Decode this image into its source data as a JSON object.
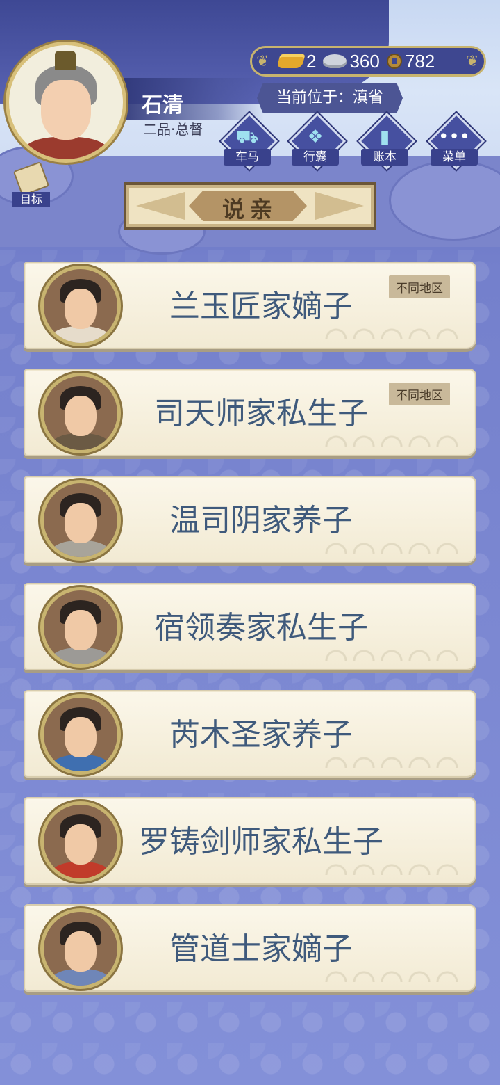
{
  "player": {
    "name": "石清",
    "rank": "二品·总督"
  },
  "currency": {
    "gold": "2",
    "silver": "360",
    "coins": "782"
  },
  "location": {
    "label": "当前位于：滇省"
  },
  "menu": {
    "carriage": "车马",
    "bag": "行囊",
    "ledger": "账本",
    "menu": "菜单",
    "goal": "目标"
  },
  "page": {
    "title": "说亲"
  },
  "candidates": [
    {
      "name": "兰玉匠家嫡子",
      "tag": "不同地区",
      "body_color": "#e6dccb"
    },
    {
      "name": "司天师家私生子",
      "tag": "不同地区",
      "body_color": "#6b5a44"
    },
    {
      "name": "温司阴家养子",
      "tag": "",
      "body_color": "#a8a49a"
    },
    {
      "name": "宿领奏家私生子",
      "tag": "",
      "body_color": "#9c9a96"
    },
    {
      "name": "芮木圣家养子",
      "tag": "",
      "body_color": "#3f6fb0"
    },
    {
      "name": "罗铸剑师家私生子",
      "tag": "",
      "body_color": "#c13b2a"
    },
    {
      "name": "管道士家嫡子",
      "tag": "",
      "body_color": "#6f86b8"
    }
  ]
}
